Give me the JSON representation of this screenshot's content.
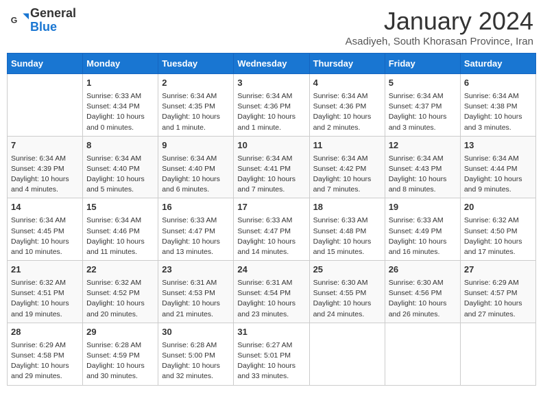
{
  "header": {
    "logo_line1": "General",
    "logo_line2": "Blue",
    "month": "January 2024",
    "location": "Asadiyeh, South Khorasan Province, Iran"
  },
  "days_of_week": [
    "Sunday",
    "Monday",
    "Tuesday",
    "Wednesday",
    "Thursday",
    "Friday",
    "Saturday"
  ],
  "weeks": [
    [
      {
        "day": "",
        "info": ""
      },
      {
        "day": "1",
        "info": "Sunrise: 6:33 AM\nSunset: 4:34 PM\nDaylight: 10 hours\nand 0 minutes."
      },
      {
        "day": "2",
        "info": "Sunrise: 6:34 AM\nSunset: 4:35 PM\nDaylight: 10 hours\nand 1 minute."
      },
      {
        "day": "3",
        "info": "Sunrise: 6:34 AM\nSunset: 4:36 PM\nDaylight: 10 hours\nand 1 minute."
      },
      {
        "day": "4",
        "info": "Sunrise: 6:34 AM\nSunset: 4:36 PM\nDaylight: 10 hours\nand 2 minutes."
      },
      {
        "day": "5",
        "info": "Sunrise: 6:34 AM\nSunset: 4:37 PM\nDaylight: 10 hours\nand 3 minutes."
      },
      {
        "day": "6",
        "info": "Sunrise: 6:34 AM\nSunset: 4:38 PM\nDaylight: 10 hours\nand 3 minutes."
      }
    ],
    [
      {
        "day": "7",
        "info": "Sunrise: 6:34 AM\nSunset: 4:39 PM\nDaylight: 10 hours\nand 4 minutes."
      },
      {
        "day": "8",
        "info": "Sunrise: 6:34 AM\nSunset: 4:40 PM\nDaylight: 10 hours\nand 5 minutes."
      },
      {
        "day": "9",
        "info": "Sunrise: 6:34 AM\nSunset: 4:40 PM\nDaylight: 10 hours\nand 6 minutes."
      },
      {
        "day": "10",
        "info": "Sunrise: 6:34 AM\nSunset: 4:41 PM\nDaylight: 10 hours\nand 7 minutes."
      },
      {
        "day": "11",
        "info": "Sunrise: 6:34 AM\nSunset: 4:42 PM\nDaylight: 10 hours\nand 7 minutes."
      },
      {
        "day": "12",
        "info": "Sunrise: 6:34 AM\nSunset: 4:43 PM\nDaylight: 10 hours\nand 8 minutes."
      },
      {
        "day": "13",
        "info": "Sunrise: 6:34 AM\nSunset: 4:44 PM\nDaylight: 10 hours\nand 9 minutes."
      }
    ],
    [
      {
        "day": "14",
        "info": "Sunrise: 6:34 AM\nSunset: 4:45 PM\nDaylight: 10 hours\nand 10 minutes."
      },
      {
        "day": "15",
        "info": "Sunrise: 6:34 AM\nSunset: 4:46 PM\nDaylight: 10 hours\nand 11 minutes."
      },
      {
        "day": "16",
        "info": "Sunrise: 6:33 AM\nSunset: 4:47 PM\nDaylight: 10 hours\nand 13 minutes."
      },
      {
        "day": "17",
        "info": "Sunrise: 6:33 AM\nSunset: 4:47 PM\nDaylight: 10 hours\nand 14 minutes."
      },
      {
        "day": "18",
        "info": "Sunrise: 6:33 AM\nSunset: 4:48 PM\nDaylight: 10 hours\nand 15 minutes."
      },
      {
        "day": "19",
        "info": "Sunrise: 6:33 AM\nSunset: 4:49 PM\nDaylight: 10 hours\nand 16 minutes."
      },
      {
        "day": "20",
        "info": "Sunrise: 6:32 AM\nSunset: 4:50 PM\nDaylight: 10 hours\nand 17 minutes."
      }
    ],
    [
      {
        "day": "21",
        "info": "Sunrise: 6:32 AM\nSunset: 4:51 PM\nDaylight: 10 hours\nand 19 minutes."
      },
      {
        "day": "22",
        "info": "Sunrise: 6:32 AM\nSunset: 4:52 PM\nDaylight: 10 hours\nand 20 minutes."
      },
      {
        "day": "23",
        "info": "Sunrise: 6:31 AM\nSunset: 4:53 PM\nDaylight: 10 hours\nand 21 minutes."
      },
      {
        "day": "24",
        "info": "Sunrise: 6:31 AM\nSunset: 4:54 PM\nDaylight: 10 hours\nand 23 minutes."
      },
      {
        "day": "25",
        "info": "Sunrise: 6:30 AM\nSunset: 4:55 PM\nDaylight: 10 hours\nand 24 minutes."
      },
      {
        "day": "26",
        "info": "Sunrise: 6:30 AM\nSunset: 4:56 PM\nDaylight: 10 hours\nand 26 minutes."
      },
      {
        "day": "27",
        "info": "Sunrise: 6:29 AM\nSunset: 4:57 PM\nDaylight: 10 hours\nand 27 minutes."
      }
    ],
    [
      {
        "day": "28",
        "info": "Sunrise: 6:29 AM\nSunset: 4:58 PM\nDaylight: 10 hours\nand 29 minutes."
      },
      {
        "day": "29",
        "info": "Sunrise: 6:28 AM\nSunset: 4:59 PM\nDaylight: 10 hours\nand 30 minutes."
      },
      {
        "day": "30",
        "info": "Sunrise: 6:28 AM\nSunset: 5:00 PM\nDaylight: 10 hours\nand 32 minutes."
      },
      {
        "day": "31",
        "info": "Sunrise: 6:27 AM\nSunset: 5:01 PM\nDaylight: 10 hours\nand 33 minutes."
      },
      {
        "day": "",
        "info": ""
      },
      {
        "day": "",
        "info": ""
      },
      {
        "day": "",
        "info": ""
      }
    ]
  ]
}
